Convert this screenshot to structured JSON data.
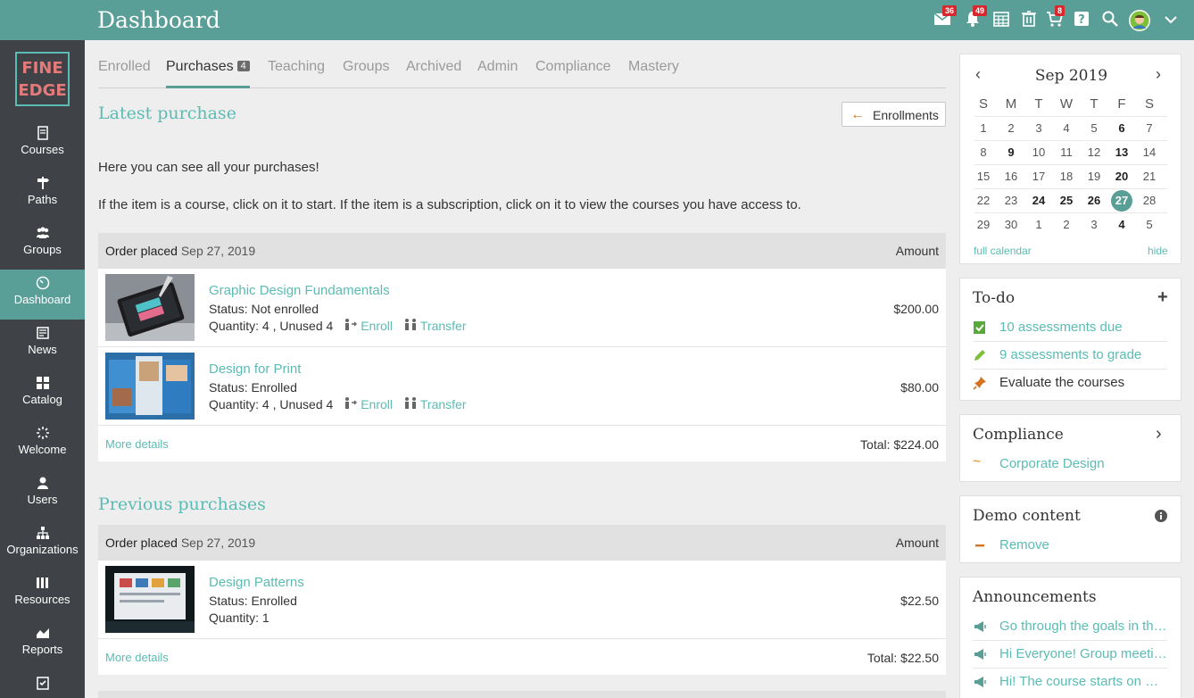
{
  "header": {
    "title": "Dashboard",
    "badges": {
      "messages": "36",
      "notifications": "49",
      "cart": "8"
    }
  },
  "sidebar": {
    "logo_line1": "FINE",
    "logo_line2": "EDGE",
    "items": [
      {
        "label": "Courses",
        "icon": "book-icon"
      },
      {
        "label": "Paths",
        "icon": "signpost-icon"
      },
      {
        "label": "Groups",
        "icon": "users-group-icon"
      },
      {
        "label": "Dashboard",
        "icon": "gauge-icon",
        "active": true
      },
      {
        "label": "News",
        "icon": "newspaper-icon"
      },
      {
        "label": "Catalog",
        "icon": "grid-icon"
      },
      {
        "label": "Welcome",
        "icon": "spinner-icon"
      },
      {
        "label": "Users",
        "icon": "user-icon"
      },
      {
        "label": "Organizations",
        "icon": "sitemap-icon"
      },
      {
        "label": "Resources",
        "icon": "library-icon"
      },
      {
        "label": "Reports",
        "icon": "area-chart-icon"
      }
    ]
  },
  "tabs": [
    {
      "label": "Enrolled"
    },
    {
      "label": "Purchases",
      "count": "4",
      "active": true
    },
    {
      "label": "Teaching"
    },
    {
      "label": "Groups"
    },
    {
      "label": "Archived"
    },
    {
      "label": "Admin"
    },
    {
      "label": "Compliance"
    },
    {
      "label": "Mastery"
    }
  ],
  "main": {
    "latest_title": "Latest purchase",
    "enrollments_button": "Enrollments",
    "intro1": "Here you can see all your purchases!",
    "intro2": "If the item is a course, click on it to start. If the item is a subscription, click on it to view the courses you have access to.",
    "previous_title": "Previous purchases",
    "order_label": "Order placed",
    "amount_label": "Amount",
    "more_details": "More details",
    "status_label": "Status:",
    "quantity_label": "Quantity:",
    "enroll_label": "Enroll",
    "transfer_label": "Transfer",
    "orders": [
      {
        "date": "Sep 27, 2019",
        "total": "Total: $224.00",
        "items": [
          {
            "name": "Graphic Design Fundamentals",
            "status": "Not enrolled",
            "quantity": "4 , Unused 4",
            "price": "$200.00"
          },
          {
            "name": "Design for Print",
            "status": "Enrolled",
            "quantity": "4 , Unused 4",
            "price": "$80.00"
          }
        ]
      },
      {
        "date": "Sep 27, 2019",
        "total": "Total: $22.50",
        "items": [
          {
            "name": "Design Patterns",
            "status": "Enrolled",
            "quantity": "1",
            "price": "$22.50"
          }
        ]
      }
    ]
  },
  "calendar": {
    "month": "Sep 2019",
    "weekdays": [
      "S",
      "M",
      "T",
      "W",
      "T",
      "F",
      "S"
    ],
    "weeks": [
      [
        "1",
        "2",
        "3",
        "4",
        "5",
        "6",
        "7"
      ],
      [
        "8",
        "9",
        "10",
        "11",
        "12",
        "13",
        "14"
      ],
      [
        "15",
        "16",
        "17",
        "18",
        "19",
        "20",
        "21"
      ],
      [
        "22",
        "23",
        "24",
        "25",
        "26",
        "27",
        "28"
      ],
      [
        "29",
        "30",
        "1",
        "2",
        "3",
        "4",
        "5"
      ]
    ],
    "bold": [
      "6",
      "9",
      "13",
      "20",
      "24",
      "25",
      "26",
      "4"
    ],
    "today": "27",
    "full_calendar": "full calendar",
    "hide": "hide"
  },
  "todo": {
    "title": "To-do",
    "items": [
      {
        "text": "10 assessments due",
        "icon": "check-square-icon",
        "link": true
      },
      {
        "text": "9 assessments to grade",
        "icon": "pencil-icon",
        "link": true
      },
      {
        "text": "Evaluate the courses",
        "icon": "pin-icon",
        "link": false
      }
    ]
  },
  "compliance": {
    "title": "Compliance",
    "item": "Corporate Design"
  },
  "demo": {
    "title": "Demo content",
    "item": "Remove"
  },
  "announcements": {
    "title": "Announcements",
    "items": [
      "Go through the goals in the course",
      "Hi Everyone! Group meeting today",
      "Hi! The course starts on Monday"
    ]
  },
  "colors": {
    "accent": "#5a9e98",
    "link": "#5abcb4",
    "sidebar": "#3f4246",
    "badge": "#d9272e"
  }
}
